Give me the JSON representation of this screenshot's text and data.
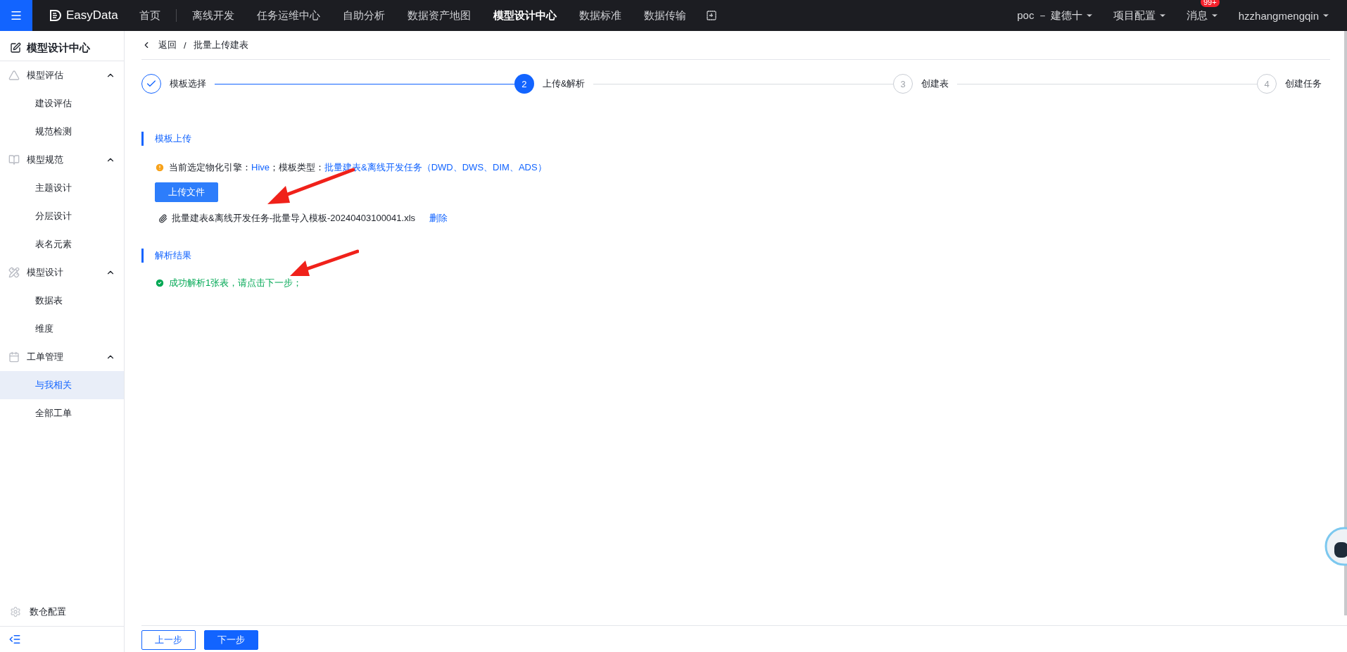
{
  "topbar": {
    "logo": "EasyData",
    "nav": [
      {
        "label": "首页",
        "selected": false
      },
      {
        "label": "离线开发",
        "selected": false
      },
      {
        "label": "任务运维中心",
        "selected": false
      },
      {
        "label": "自助分析",
        "selected": false
      },
      {
        "label": "数据资产地图",
        "selected": false
      },
      {
        "label": "模型设计中心",
        "selected": true
      },
      {
        "label": "数据标准",
        "selected": false
      },
      {
        "label": "数据传输",
        "selected": false
      }
    ],
    "right": [
      {
        "label": "poc － 建德十"
      },
      {
        "label": "项目配置"
      },
      {
        "label": "消息",
        "badge": "99+"
      },
      {
        "label": "hzzhangmengqin"
      }
    ]
  },
  "sidebar": {
    "title": "模型设计中心",
    "groups": [
      {
        "kind": "assess",
        "label": "模型评估",
        "expanded": true,
        "children": [
          {
            "label": "建设评估",
            "selected": false
          },
          {
            "label": "规范检测",
            "selected": false
          }
        ]
      },
      {
        "kind": "spec",
        "label": "模型规范",
        "expanded": true,
        "children": [
          {
            "label": "主题设计",
            "selected": false
          },
          {
            "label": "分层设计",
            "selected": false
          },
          {
            "label": "表名元素",
            "selected": false
          }
        ]
      },
      {
        "kind": "design",
        "label": "模型设计",
        "expanded": true,
        "children": [
          {
            "label": "数据表",
            "selected": false
          },
          {
            "label": "维度",
            "selected": false
          }
        ]
      },
      {
        "kind": "ticket",
        "label": "工单管理",
        "expanded": true,
        "children": [
          {
            "label": "与我相关",
            "selected": true
          },
          {
            "label": "全部工单",
            "selected": false
          }
        ]
      }
    ],
    "footer": "数仓配置"
  },
  "breadcrumb": {
    "back": "返回",
    "separator": "/",
    "current": "批量上传建表"
  },
  "steps": [
    {
      "label": "模板选择",
      "completed": true,
      "selected": false
    },
    {
      "number": "2",
      "label": "上传&解析",
      "completed": false,
      "selected": true
    },
    {
      "number": "3",
      "label": "创建表",
      "completed": false,
      "selected": false
    },
    {
      "number": "4",
      "label": "创建任务",
      "completed": false,
      "selected": false
    }
  ],
  "upload_section": {
    "title": "模板上传",
    "notice": {
      "prefix": "当前选定物化引擎：",
      "engine": "Hive",
      "middle": "；模板类型：",
      "template": "批量建表&离线开发任务（DWD、DWS、DIM、ADS）"
    },
    "button": "上传文件",
    "file": {
      "name": "批量建表&离线开发任务-批量导入模板-20240403100041.xls",
      "delete": "删除"
    }
  },
  "result_section": {
    "title": "解析结果",
    "message": "成功解析1张表，请点击下一步；"
  },
  "footer_buttons": [
    {
      "label": "上一步",
      "primary": false
    },
    {
      "label": "下一步",
      "primary": true
    }
  ]
}
